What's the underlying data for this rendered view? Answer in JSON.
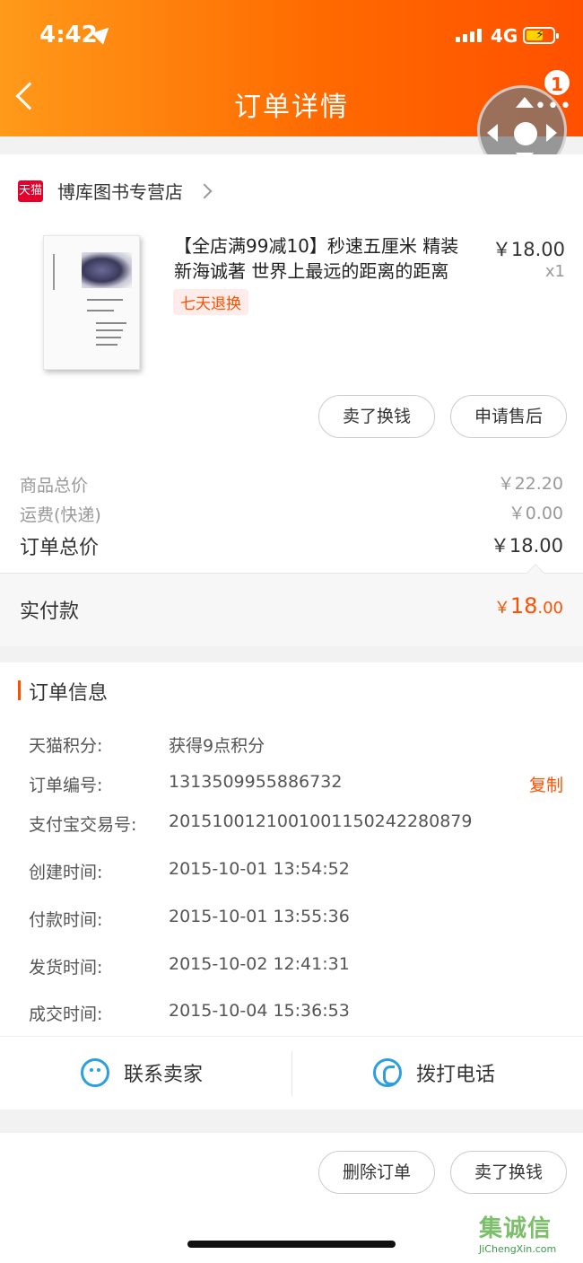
{
  "status_bar": {
    "time": "4:42",
    "network": "4G"
  },
  "header": {
    "title": "订单详情",
    "badge_count": "1"
  },
  "store": {
    "logo_text": "天猫",
    "name": "博库图书专营店"
  },
  "product": {
    "title": "【全店满99减10】秒速五厘米 精装 新海诚著 世界上最远的距离的距离",
    "price": "￥18.00",
    "qty": "x1",
    "tag": "七天退换",
    "buttons": [
      "卖了换钱",
      "申请售后"
    ]
  },
  "fees": {
    "goods_label": "商品总价",
    "goods_value": "￥22.20",
    "shipping_label": "运费(快递)",
    "shipping_value": "￥0.00",
    "total_label": "订单总价",
    "total_value": "￥18.00",
    "paid_label": "实付款",
    "paid_currency": "￥",
    "paid_int": "18",
    "paid_dec": ".00"
  },
  "order_info": {
    "title": "订单信息",
    "copy_label": "复制",
    "rows": [
      {
        "label": "天猫积分:",
        "value": "获得9点积分"
      },
      {
        "label": "订单编号:",
        "value": "1313509955886732"
      },
      {
        "label": "支付宝交易号:",
        "value": "2015100121001001150242280879"
      },
      {
        "label": "创建时间:",
        "value": "2015-10-01 13:54:52"
      },
      {
        "label": "付款时间:",
        "value": "2015-10-01 13:55:36"
      },
      {
        "label": "发货时间:",
        "value": "2015-10-02 12:41:31"
      },
      {
        "label": "成交时间:",
        "value": "2015-10-04 15:36:53"
      }
    ]
  },
  "contact": {
    "seller_label": "联系卖家",
    "phone_label": "拨打电话"
  },
  "bottom_actions": [
    "删除订单",
    "卖了换钱"
  ],
  "watermark": {
    "cn": "集诚信",
    "en": "JiChengXin.com"
  },
  "colors": {
    "accent": "#ff5000",
    "header_start": "#ff9a1a",
    "link_blue": "#2b9fe0"
  }
}
